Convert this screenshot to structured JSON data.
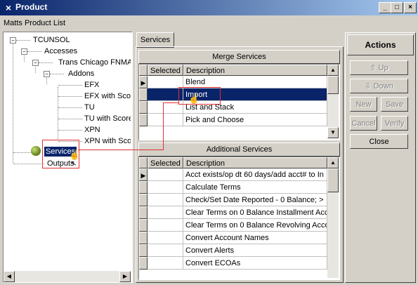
{
  "window": {
    "title": "Product",
    "icon": "x-app-icon",
    "controls": [
      "_",
      "□",
      "×"
    ]
  },
  "list_label": "Matts Product List",
  "tree": {
    "nodes": [
      {
        "label": "TCUNSOL",
        "expander": "−"
      },
      {
        "label": "Accesses",
        "expander": "−"
      },
      {
        "label": "Trans Chicago FNMA",
        "expander": "−"
      },
      {
        "label": "Addons",
        "expander": "−"
      },
      {
        "label": "EFX"
      },
      {
        "label": "EFX with Sco"
      },
      {
        "label": "TU"
      },
      {
        "label": "TU with Score"
      },
      {
        "label": "XPN"
      },
      {
        "label": "XPN with Sco"
      },
      {
        "label": "Services",
        "selected": true,
        "icon": "green-ball-icon"
      },
      {
        "label": "Outputs"
      }
    ]
  },
  "tab": {
    "label": "Services"
  },
  "merge": {
    "title": "Merge Services",
    "columns": [
      "Selected",
      "Description"
    ],
    "rows": [
      "Blend",
      "Import",
      "List and Stack",
      "Pick and Choose"
    ],
    "selected_index": 1
  },
  "additional": {
    "title": "Additional Services",
    "columns": [
      "Selected",
      "Description"
    ],
    "rows": [
      "Acct exists/op dt 60 days/add acct# to In",
      "Calculate Terms",
      "Check/Set Date Reported - 0 Balance; >",
      "Clear Terms on 0 Balance Installment Acc",
      "Clear Terms on 0 Balance Revolving Acco",
      "Convert Account Names",
      "Convert Alerts",
      "Convert ECOAs"
    ]
  },
  "actions": {
    "title": "Actions",
    "up": "Up",
    "down": "Down",
    "new": "New",
    "save": "Save",
    "cancel": "Cancel",
    "verify": "Verify",
    "close": "Close"
  },
  "colors": {
    "title_start": "#0a246a",
    "title_end": "#a6caf0",
    "selection": "#0a246a",
    "highlight_box": "#e03030"
  }
}
